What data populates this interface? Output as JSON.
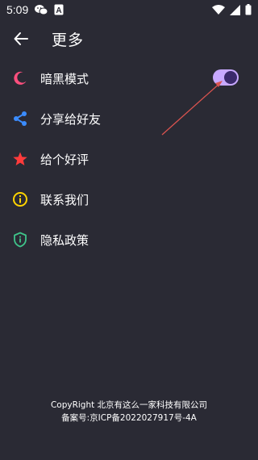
{
  "status_bar": {
    "time": "5:09",
    "left_icons": [
      "wechat-icon",
      "a-icon"
    ],
    "right_icons": [
      "wifi-icon",
      "signal-icon",
      "battery-icon"
    ]
  },
  "header": {
    "back_icon": "arrow-left-icon",
    "title": "更多"
  },
  "menu": {
    "items": [
      {
        "id": "dark-mode",
        "label": "暗黑模式",
        "icon": "moon-icon",
        "icon_color": "#ff4f7e",
        "has_toggle": true,
        "toggle_on": true
      },
      {
        "id": "share",
        "label": "分享给好友",
        "icon": "share-icon",
        "icon_color": "#3b8cff"
      },
      {
        "id": "rate",
        "label": "给个好评",
        "icon": "star-icon",
        "icon_color": "#ff3b3b"
      },
      {
        "id": "contact",
        "label": "联系我们",
        "icon": "info-icon",
        "icon_color": "#ffd400"
      },
      {
        "id": "privacy",
        "label": "隐私政策",
        "icon": "shield-icon",
        "icon_color": "#3fc48a"
      }
    ]
  },
  "toggle": {
    "on_color": "#c8a9ff",
    "knob_color": "#3b2a6b"
  },
  "footer": {
    "copyright": "CopyRight 北京有这么一家科技有限公司",
    "icp": "备案号:京ICP备2022027917号-4A"
  },
  "colors": {
    "background": "#2a2a34",
    "annotation_arrow": "#d9534f"
  }
}
